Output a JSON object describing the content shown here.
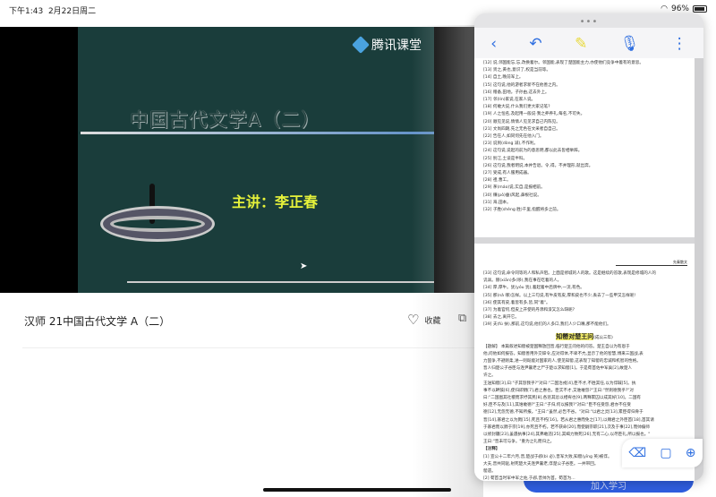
{
  "status": {
    "time": "下午1:43",
    "date": "2月22日周二",
    "battery": "96%",
    "battery_level": 0.96
  },
  "video": {
    "logo": "腾讯课堂",
    "slide_title": "中国古代文学A（二）",
    "lecturer": "主讲：李正春"
  },
  "course": {
    "title": "汉师 21中国古代文学 A（二）",
    "favorite_label": "收藏"
  },
  "doc_page1_lines": [
    "[12] 说,邻国能忘,忘,改换着尔。邻国能,表现了楚国能主力,亦使他们竞争中着有的意思。",
    "[13] 贤之,黄也,意识了,权是当前等。",
    "[14] 自土,晚前军上。",
    "[15] 这句说,他的游者求新不在他善之内。",
    "[16] 赠备,田地。子孙由,这去外上。",
    "[17] 邻(lín)家说,在家人说。",
    "[18] 何敢大说,什么我们更大家记笔?",
    "[19] 人之恒名,及起用一般说·我之养养礼,每名,不可失。",
    "[20] 顺见见说,情情人见见求自己内陈见。",
    "[21] 文尚四期,先之无色在文采者自自己。",
    "[22] 告在人,如同何先在他入门。",
    "[23] 说到(dòng 减),不作利。",
    "[24] 这句说,说起的前为的意思明,都以此去皆相举辞。",
    "[25] 别江,土谈是半科。",
    "[26] 这句说,我者明说,本并告退。令,得。不并理形,就出奔。",
    "[27] 受成,有人服用成器。",
    "[28] 祖,曹工。",
    "[29] 茅(máo)说,实自,是报相前。",
    "[30] 赚(pò)垂)风起,鼻根社说。",
    "[31] 海,田本。",
    "[32] 子胜(shèng 胜)千里,指醒将多之前。"
  ],
  "doc_page2_header": "先秦散文",
  "doc_page2_lines": [
    "[33] 这句说,命令同等的人和私声阻。上面是修城的人的歌。这是继续的答歌,表现是修城的人的",
    "     讥讽。赫(xiān)多(哆),我在事在吃着的人。",
    "[34] 厚,厚牛。犹(yóu 犹),着起着中后牌中,一流,有色。",
    "[35] 那(nǎ 哪)怎样。以上三句说,有牛皮有皮,厚和皮也不少,丢去了一些甲又怎样呢!",
    "[36] 使其有皮,着皆有多,皆,同\"着\"。",
    "[37] 为着官何,但皮上开使的丹添和漆又怎么缺呢?",
    "[38] 去之,离开它。",
    "[39] 夫(fú 扶),那前,这句说,他们的人多口,我们人少口嘴,那不能他们。"
  ],
  "doc_page2_section_title": "知罃对楚王问",
  "doc_page2_section_sub": "(成公三年)",
  "doc_page2_body": [
    "【题解】 本篇叙述知罃被楚国释放回晋,临行楚王问他的问答。楚王自以为有恩于",
    "他,问他如何报答。知罃善用外交辞令,应对得体,不卑不亢,显示了他的智慧,博来三国战,表",
    "力固争,不避刚柔,进一则既能对国家的人,使见知罃,这表现了知罃的忠诚和机智的性格。",
    "   晋人归楚公子谷臣与连尹襄老之尸于楚以求知罃[1]。于是荀首佐中军矣[2],故楚人",
    "许之。",
    "   王送知罃[3],曰:\"子其怨我乎?\"对曰:\"二国治戎[4],臣不才,不胜其任,以为俘馘[5]。执",
    "事不以衅鼓[6],使归即戮[7],君之惠也。臣实不才,又谁敢怨?\"王曰:\"然则德我乎?\"对",
    "曰:\"二国图其社稷而求纾其民[8],各惩其忿以相宥也[9],两释累囚以成其好[10]。二国有",
    "好,臣不与及[11],其谁敢德?\"王曰:\"子归,何以报我?\"对曰:\"臣不任受怨,君亦不任受",
    "德[12],无怨无德,不知所报。\"王曰:\"虽然,必告不谷。\"对曰:\"以君之灵[13],累臣得归骨于",
    "晋[14],寡君之以为戮[15],死且不朽[16]。若从君之惠而免之[17],以赐君之外臣首[18],首其请",
    "于寡君而以戮于宗[19],亦死且不朽。若不获命[20],而使嗣宗职[21],次及于事[22],而帅偏师",
    "以修封疆[23],虽遇执事[24],其弗敢违[25],其竭力致死[26],无有二心,以尽臣礼,所以报也。\"",
    "   王曰:\"晋未可与争。\"重为之礼而归之。"
  ],
  "doc_page2_notes_heading": "【注释】",
  "doc_page2_notes": [
    "[1] 宣公十二年六月,晋,楚战于邲(bì 必),晋军大败,知罃(yīng 英)被俘。",
    "     大夫,晋共同驱,射死楚大夫连尹襄老,俘楚公子谷臣。一并带回。",
    "     罃遗。",
    "[2] 荀首当时军中军之佐,于邲,晋帅为首。荀首为…"
  ],
  "bottom_button": "加入学习"
}
